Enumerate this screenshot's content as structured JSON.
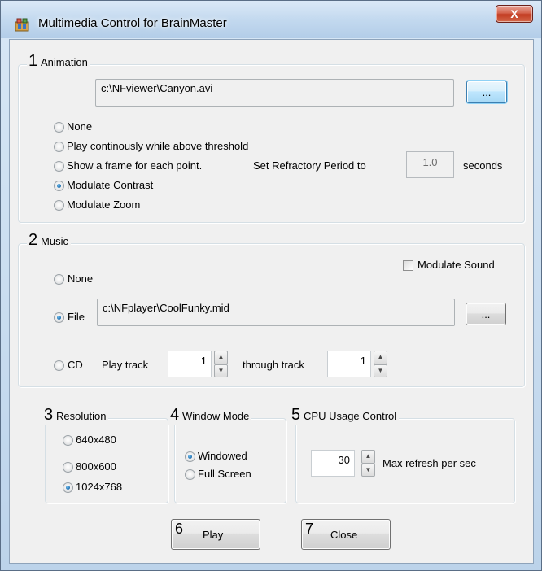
{
  "window": {
    "title": "Multimedia Control for BrainMaster",
    "close_label": "X"
  },
  "animation": {
    "number": "1",
    "label": "Animation",
    "file_path": "c:\\NFviewer\\Canyon.avi",
    "browse_label": "...",
    "options": [
      {
        "label": "None",
        "checked": false
      },
      {
        "label": "Play continously while above threshold",
        "checked": false
      },
      {
        "label": "Show a frame for each point.",
        "checked": false
      },
      {
        "label": "Modulate Contrast",
        "checked": true
      },
      {
        "label": "Modulate Zoom",
        "checked": false
      }
    ],
    "refractory_label": "Set Refractory Period to",
    "refractory_value": "1.0",
    "refractory_unit": "seconds"
  },
  "music": {
    "number": "2",
    "label": "Music",
    "modulate_sound_label": "Modulate Sound",
    "modulate_sound_checked": false,
    "none_label": "None",
    "file_label": "File",
    "file_path": "c:\\NFplayer\\CoolFunky.mid",
    "browse_label": "...",
    "cd_label": "CD",
    "play_track_label": "Play track",
    "play_track_value": "1",
    "through_track_label": "through track",
    "through_track_value": "1",
    "selected": "File"
  },
  "resolution": {
    "number": "3",
    "label": "Resolution",
    "options": [
      {
        "label": "640x480",
        "checked": false
      },
      {
        "label": "800x600",
        "checked": false
      },
      {
        "label": "1024x768",
        "checked": true
      }
    ]
  },
  "window_mode": {
    "number": "4",
    "label": "Window Mode",
    "options": [
      {
        "label": "Windowed",
        "checked": true
      },
      {
        "label": "Full Screen",
        "checked": false
      }
    ]
  },
  "cpu": {
    "number": "5",
    "label": "CPU Usage Control",
    "value": "30",
    "suffix": "Max refresh per sec"
  },
  "buttons": {
    "play_number": "6",
    "play_label": "Play",
    "close_number": "7",
    "close_label": "Close"
  },
  "icons": {
    "spin_up": "▲",
    "spin_down": "▼"
  }
}
